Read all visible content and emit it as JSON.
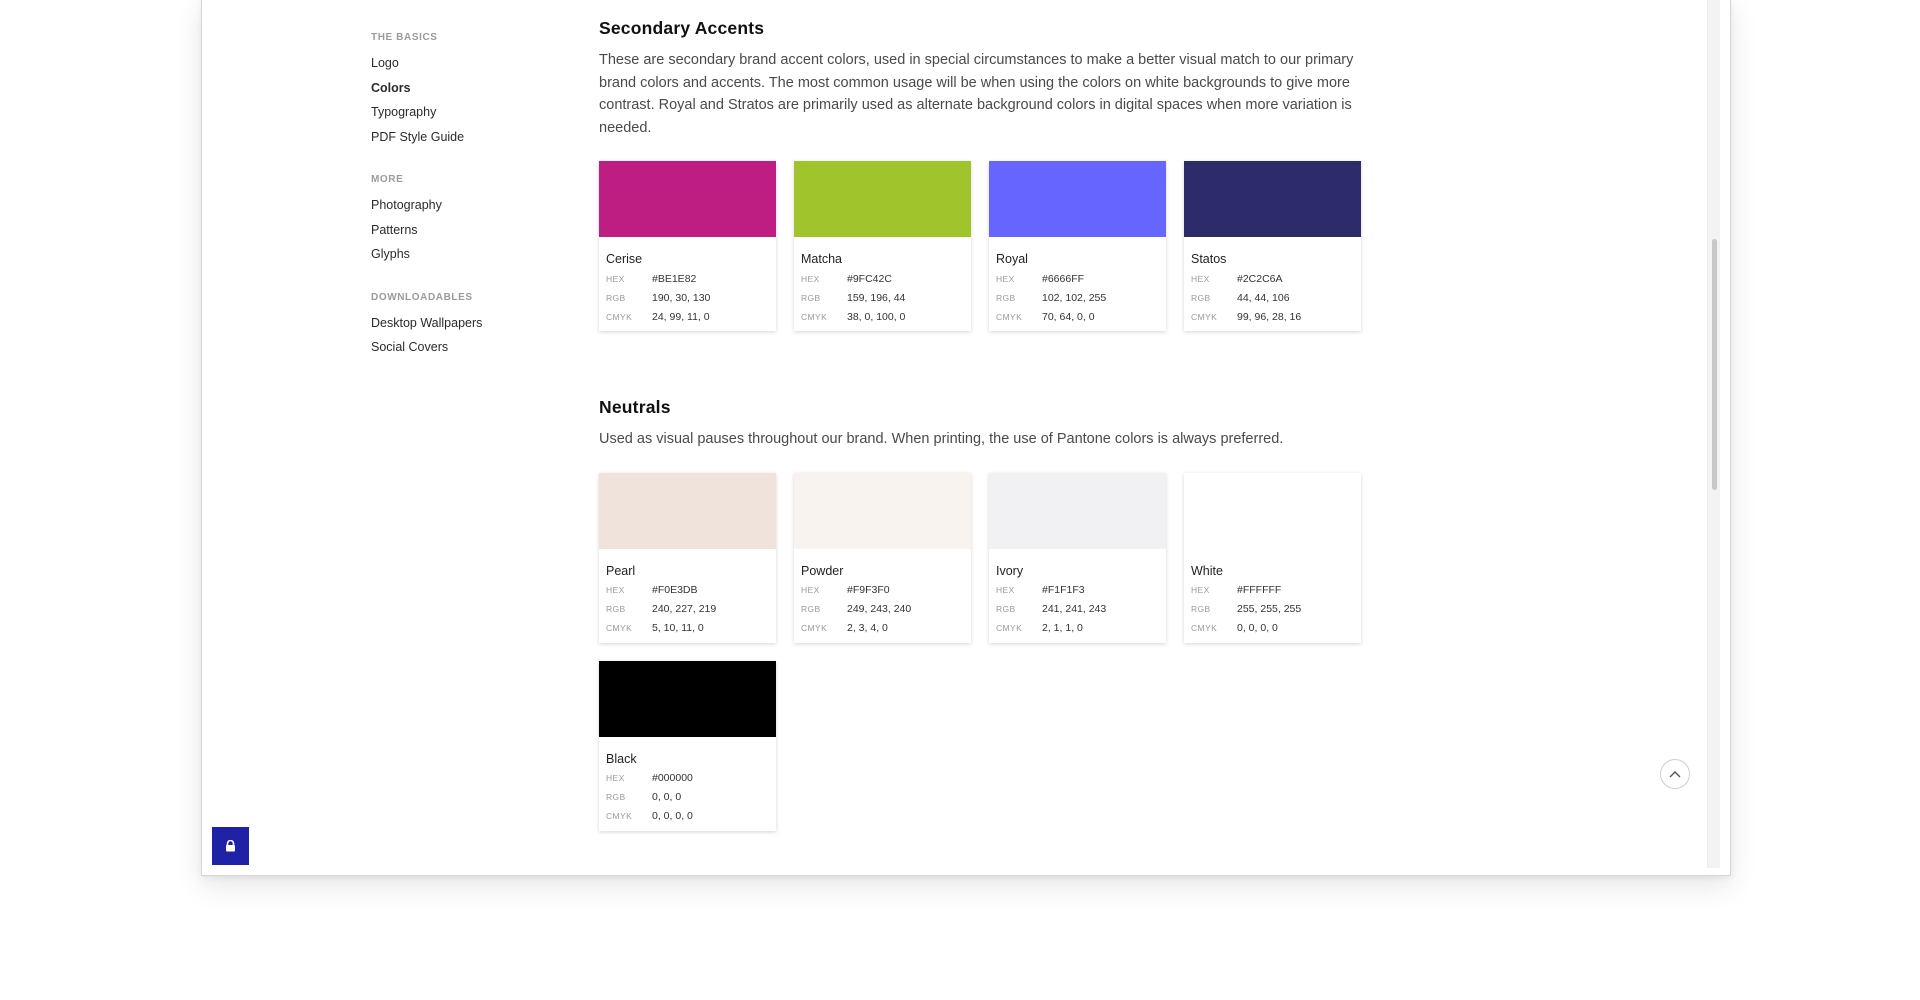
{
  "sidebar": {
    "groups": [
      {
        "heading": "THE BASICS",
        "items": [
          {
            "label": "Logo"
          },
          {
            "label": "Colors"
          },
          {
            "label": "Typography"
          },
          {
            "label": "PDF Style Guide"
          }
        ]
      },
      {
        "heading": "MORE",
        "items": [
          {
            "label": "Photography"
          },
          {
            "label": "Patterns"
          },
          {
            "label": "Glyphs"
          }
        ]
      },
      {
        "heading": "DOWNLOADABLES",
        "items": [
          {
            "label": "Desktop Wallpapers"
          },
          {
            "label": "Social Covers"
          }
        ]
      }
    ]
  },
  "labels": {
    "hex": "HEX",
    "rgb": "RGB",
    "cmyk": "CMYK"
  },
  "secondary": {
    "title": "Secondary Accents",
    "description": "These are secondary brand accent colors, used in special circumstances to make a better visual match to our primary brand colors and accents. The most common usage will be when using the colors on white backgrounds to give more contrast. Royal and Stratos are primarily used as alternate background colors in digital spaces when more variation is needed.",
    "swatches": [
      {
        "name": "Cerise",
        "hex": "#BE1E82",
        "rgb": "190, 30, 130",
        "cmyk": "24, 99, 11, 0",
        "color": "#BE1E82"
      },
      {
        "name": "Matcha",
        "hex": "#9FC42C",
        "rgb": "159, 196, 44",
        "cmyk": "38, 0, 100, 0",
        "color": "#9FC42C"
      },
      {
        "name": "Royal",
        "hex": "#6666FF",
        "rgb": "102, 102, 255",
        "cmyk": "70, 64, 0, 0",
        "color": "#6666FF"
      },
      {
        "name": "Statos",
        "hex": "#2C2C6A",
        "rgb": "44, 44, 106",
        "cmyk": "99, 96, 28, 16",
        "color": "#2C2C6A"
      }
    ]
  },
  "neutrals": {
    "title": "Neutrals",
    "description": "Used as visual pauses throughout our brand. When printing, the use of Pantone colors is always preferred.",
    "swatches": [
      {
        "name": "Pearl",
        "hex": "#F0E3DB",
        "rgb": "240, 227, 219",
        "cmyk": "5, 10, 11, 0",
        "color": "#F0E3DB"
      },
      {
        "name": "Powder",
        "hex": "#F9F3F0",
        "rgb": "249, 243, 240",
        "cmyk": "2, 3, 4, 0",
        "color": "#F9F3F0"
      },
      {
        "name": "Ivory",
        "hex": "#F1F1F3",
        "rgb": "241, 241, 243",
        "cmyk": "2, 1, 1, 0",
        "color": "#F1F1F3"
      },
      {
        "name": "White",
        "hex": "#FFFFFF",
        "rgb": "255, 255, 255",
        "cmyk": "0, 0, 0, 0",
        "color": "#FFFFFF"
      },
      {
        "name": "Black",
        "hex": "#000000",
        "rgb": "0, 0, 0",
        "cmyk": "0, 0, 0, 0",
        "color": "#000000"
      }
    ]
  },
  "icons": {
    "back_to_top": "chevron-up-icon",
    "lock": "lock-icon"
  },
  "colors": {
    "lock_button_bg": "#1F22A6"
  }
}
